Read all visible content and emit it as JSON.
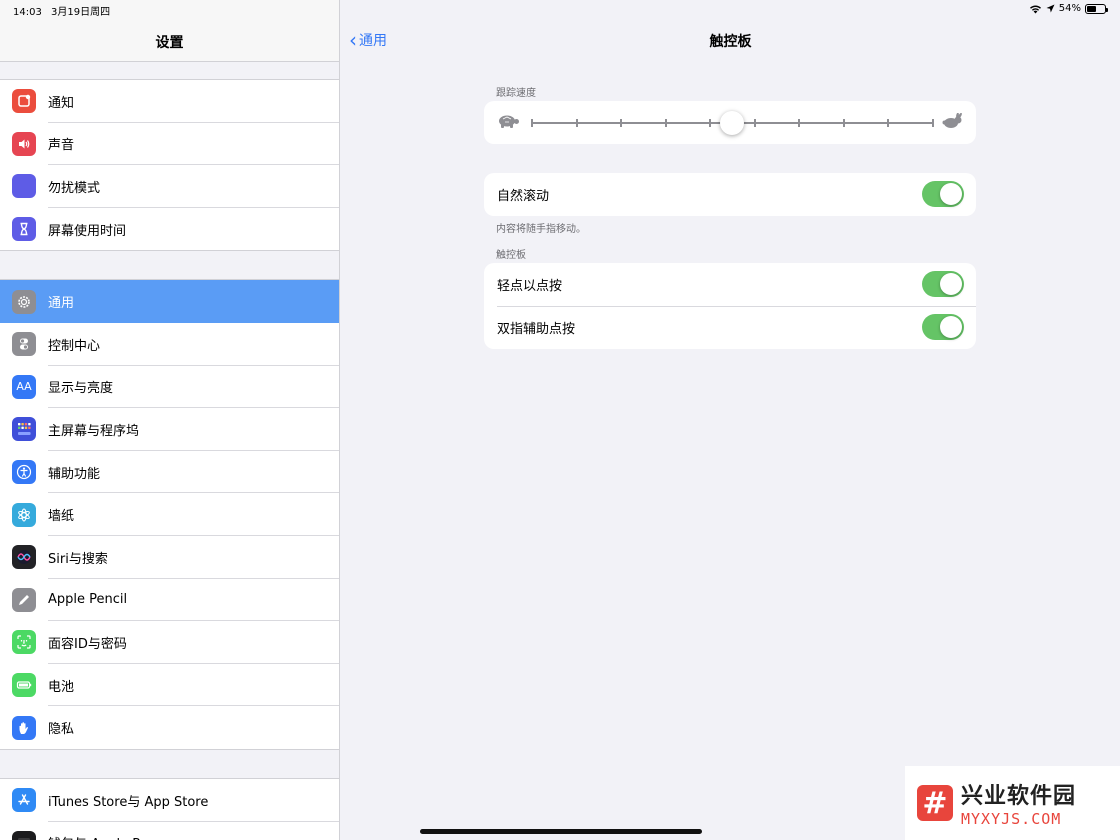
{
  "status_bar": {
    "time": "14:03",
    "date": "3月19日周四",
    "battery": "54%",
    "battery_level": 0.54
  },
  "sidebar": {
    "title": "设置",
    "groups": [
      [
        {
          "label": "通知",
          "icon": "bell-icon",
          "color": "#eb4d3d"
        },
        {
          "label": "声音",
          "icon": "speaker-icon",
          "color": "#e64552"
        },
        {
          "label": "勿扰模式",
          "icon": "moon-icon",
          "color": "#5e5ce6"
        },
        {
          "label": "屏幕使用时间",
          "icon": "hourglass-icon",
          "color": "#5e5ce6"
        }
      ],
      [
        {
          "label": "通用",
          "icon": "gear-icon",
          "color": "#8e8e93",
          "selected": true
        },
        {
          "label": "控制中心",
          "icon": "toggles-icon",
          "color": "#8e8e93"
        },
        {
          "label": "显示与亮度",
          "icon": "text-size-icon",
          "color": "#3478f6"
        },
        {
          "label": "主屏幕与程序坞",
          "icon": "grid-icon",
          "color": "#3f4fd9"
        },
        {
          "label": "辅助功能",
          "icon": "accessibility-icon",
          "color": "#3478f6"
        },
        {
          "label": "墙纸",
          "icon": "flower-icon",
          "color": "#35aadc"
        },
        {
          "label": "Siri与搜索",
          "icon": "siri-icon",
          "color": "#222226"
        },
        {
          "label": "Apple Pencil",
          "icon": "pencil-icon",
          "color": "#8e8e93"
        },
        {
          "label": "面容ID与密码",
          "icon": "face-id-icon",
          "color": "#4cd964"
        },
        {
          "label": "电池",
          "icon": "battery-icon",
          "color": "#4cd964"
        },
        {
          "label": "隐私",
          "icon": "hand-icon",
          "color": "#3478f6"
        }
      ],
      [
        {
          "label": "iTunes Store与 App Store",
          "icon": "app-store-icon",
          "color": "#2f8af5"
        },
        {
          "label": "钱包与 Apple Pay",
          "icon": "wallet-icon",
          "color": "#1c1c1e"
        }
      ]
    ]
  },
  "main": {
    "back_label": "通用",
    "title": "触控板",
    "tracking": {
      "label": "跟踪速度",
      "value_fraction": 0.5,
      "ticks": 10
    },
    "natural_scroll": {
      "label": "自然滚动",
      "on": true,
      "footnote": "内容将随手指移动。"
    },
    "trackpad_section": {
      "header": "触控板",
      "rows": [
        {
          "label": "轻点以点按",
          "on": true
        },
        {
          "label": "双指辅助点按",
          "on": true
        }
      ]
    }
  },
  "watermark": {
    "logo": "#",
    "cn": "兴业软件园",
    "en": "MYXYJS.COM"
  }
}
